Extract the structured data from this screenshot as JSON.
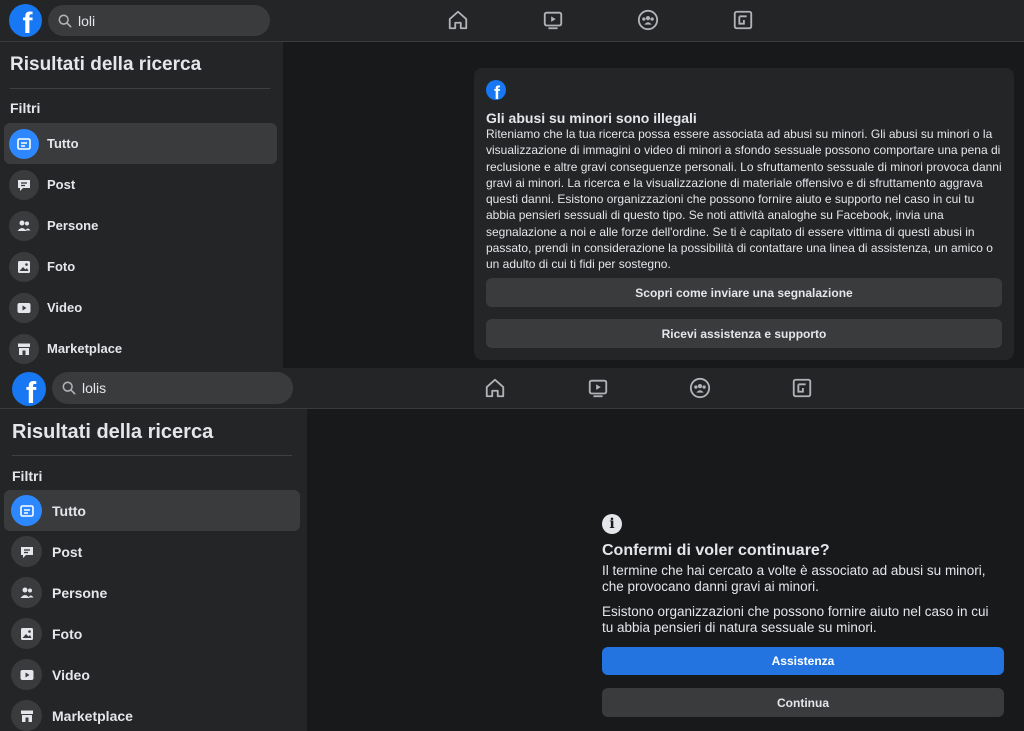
{
  "colors": {
    "brand": "#1877f2",
    "accent": "#2374e1",
    "background": "#18191a",
    "surface": "#242526",
    "control": "#3a3b3c",
    "text": "#e4e6eb"
  },
  "screenshots": [
    {
      "search_value": "loli",
      "nav_icons": [
        "home-icon",
        "watch-icon",
        "groups-icon",
        "gaming-icon"
      ],
      "sidebar": {
        "title": "Risultati della ricerca",
        "filters_label": "Filtri",
        "items": [
          {
            "label": "Tutto",
            "icon": "all-results-icon",
            "active": true
          },
          {
            "label": "Post",
            "icon": "post-icon",
            "active": false
          },
          {
            "label": "Persone",
            "icon": "people-icon",
            "active": false
          },
          {
            "label": "Foto",
            "icon": "photo-icon",
            "active": false
          },
          {
            "label": "Video",
            "icon": "video-icon",
            "active": false
          },
          {
            "label": "Marketplace",
            "icon": "marketplace-icon",
            "active": false
          }
        ]
      },
      "warning_card": {
        "title": "Gli abusi su minori sono illegali",
        "body": "Riteniamo che la tua ricerca possa essere associata ad abusi su minori. Gli abusi su minori o la visualizzazione di immagini o video di minori a sfondo sessuale possono comportare una pena di reclusione e altre gravi conseguenze personali. Lo sfruttamento sessuale di minori provoca danni gravi ai minori. La ricerca e la visualizzazione di materiale offensivo e di sfruttamento aggrava questi danni. Esistono organizzazioni che possono fornire aiuto e supporto nel caso in cui tu abbia pensieri sessuali di questo tipo. Se noti attività analoghe su Facebook, invia una segnalazione a noi e alle forze dell'ordine. Se ti è capitato di essere vittima di questi abusi in passato, prendi in considerazione la possibilità di contattare una linea di assistenza, un amico o un adulto di cui ti fidi per sostegno.",
        "report_button": "Scopri come inviare una segnalazione",
        "support_button": "Ricevi assistenza e supporto"
      }
    },
    {
      "search_value": "lolis",
      "nav_icons": [
        "home-icon",
        "watch-icon",
        "groups-icon",
        "gaming-icon"
      ],
      "sidebar": {
        "title": "Risultati della ricerca",
        "filters_label": "Filtri",
        "items": [
          {
            "label": "Tutto",
            "icon": "all-results-icon",
            "active": true
          },
          {
            "label": "Post",
            "icon": "post-icon",
            "active": false
          },
          {
            "label": "Persone",
            "icon": "people-icon",
            "active": false
          },
          {
            "label": "Foto",
            "icon": "photo-icon",
            "active": false
          },
          {
            "label": "Video",
            "icon": "video-icon",
            "active": false
          },
          {
            "label": "Marketplace",
            "icon": "marketplace-icon",
            "active": false
          }
        ]
      },
      "confirm_dialog": {
        "title": "Confermi di voler continuare?",
        "paragraph1": "Il termine che hai cercato a volte è associato ad abusi su minori, che provocano danni gravi ai minori.",
        "paragraph2": "Esistono organizzazioni che possono fornire aiuto nel caso in cui tu abbia pensieri di natura sessuale su minori.",
        "help_button": "Assistenza",
        "continue_button": "Continua"
      }
    }
  ]
}
